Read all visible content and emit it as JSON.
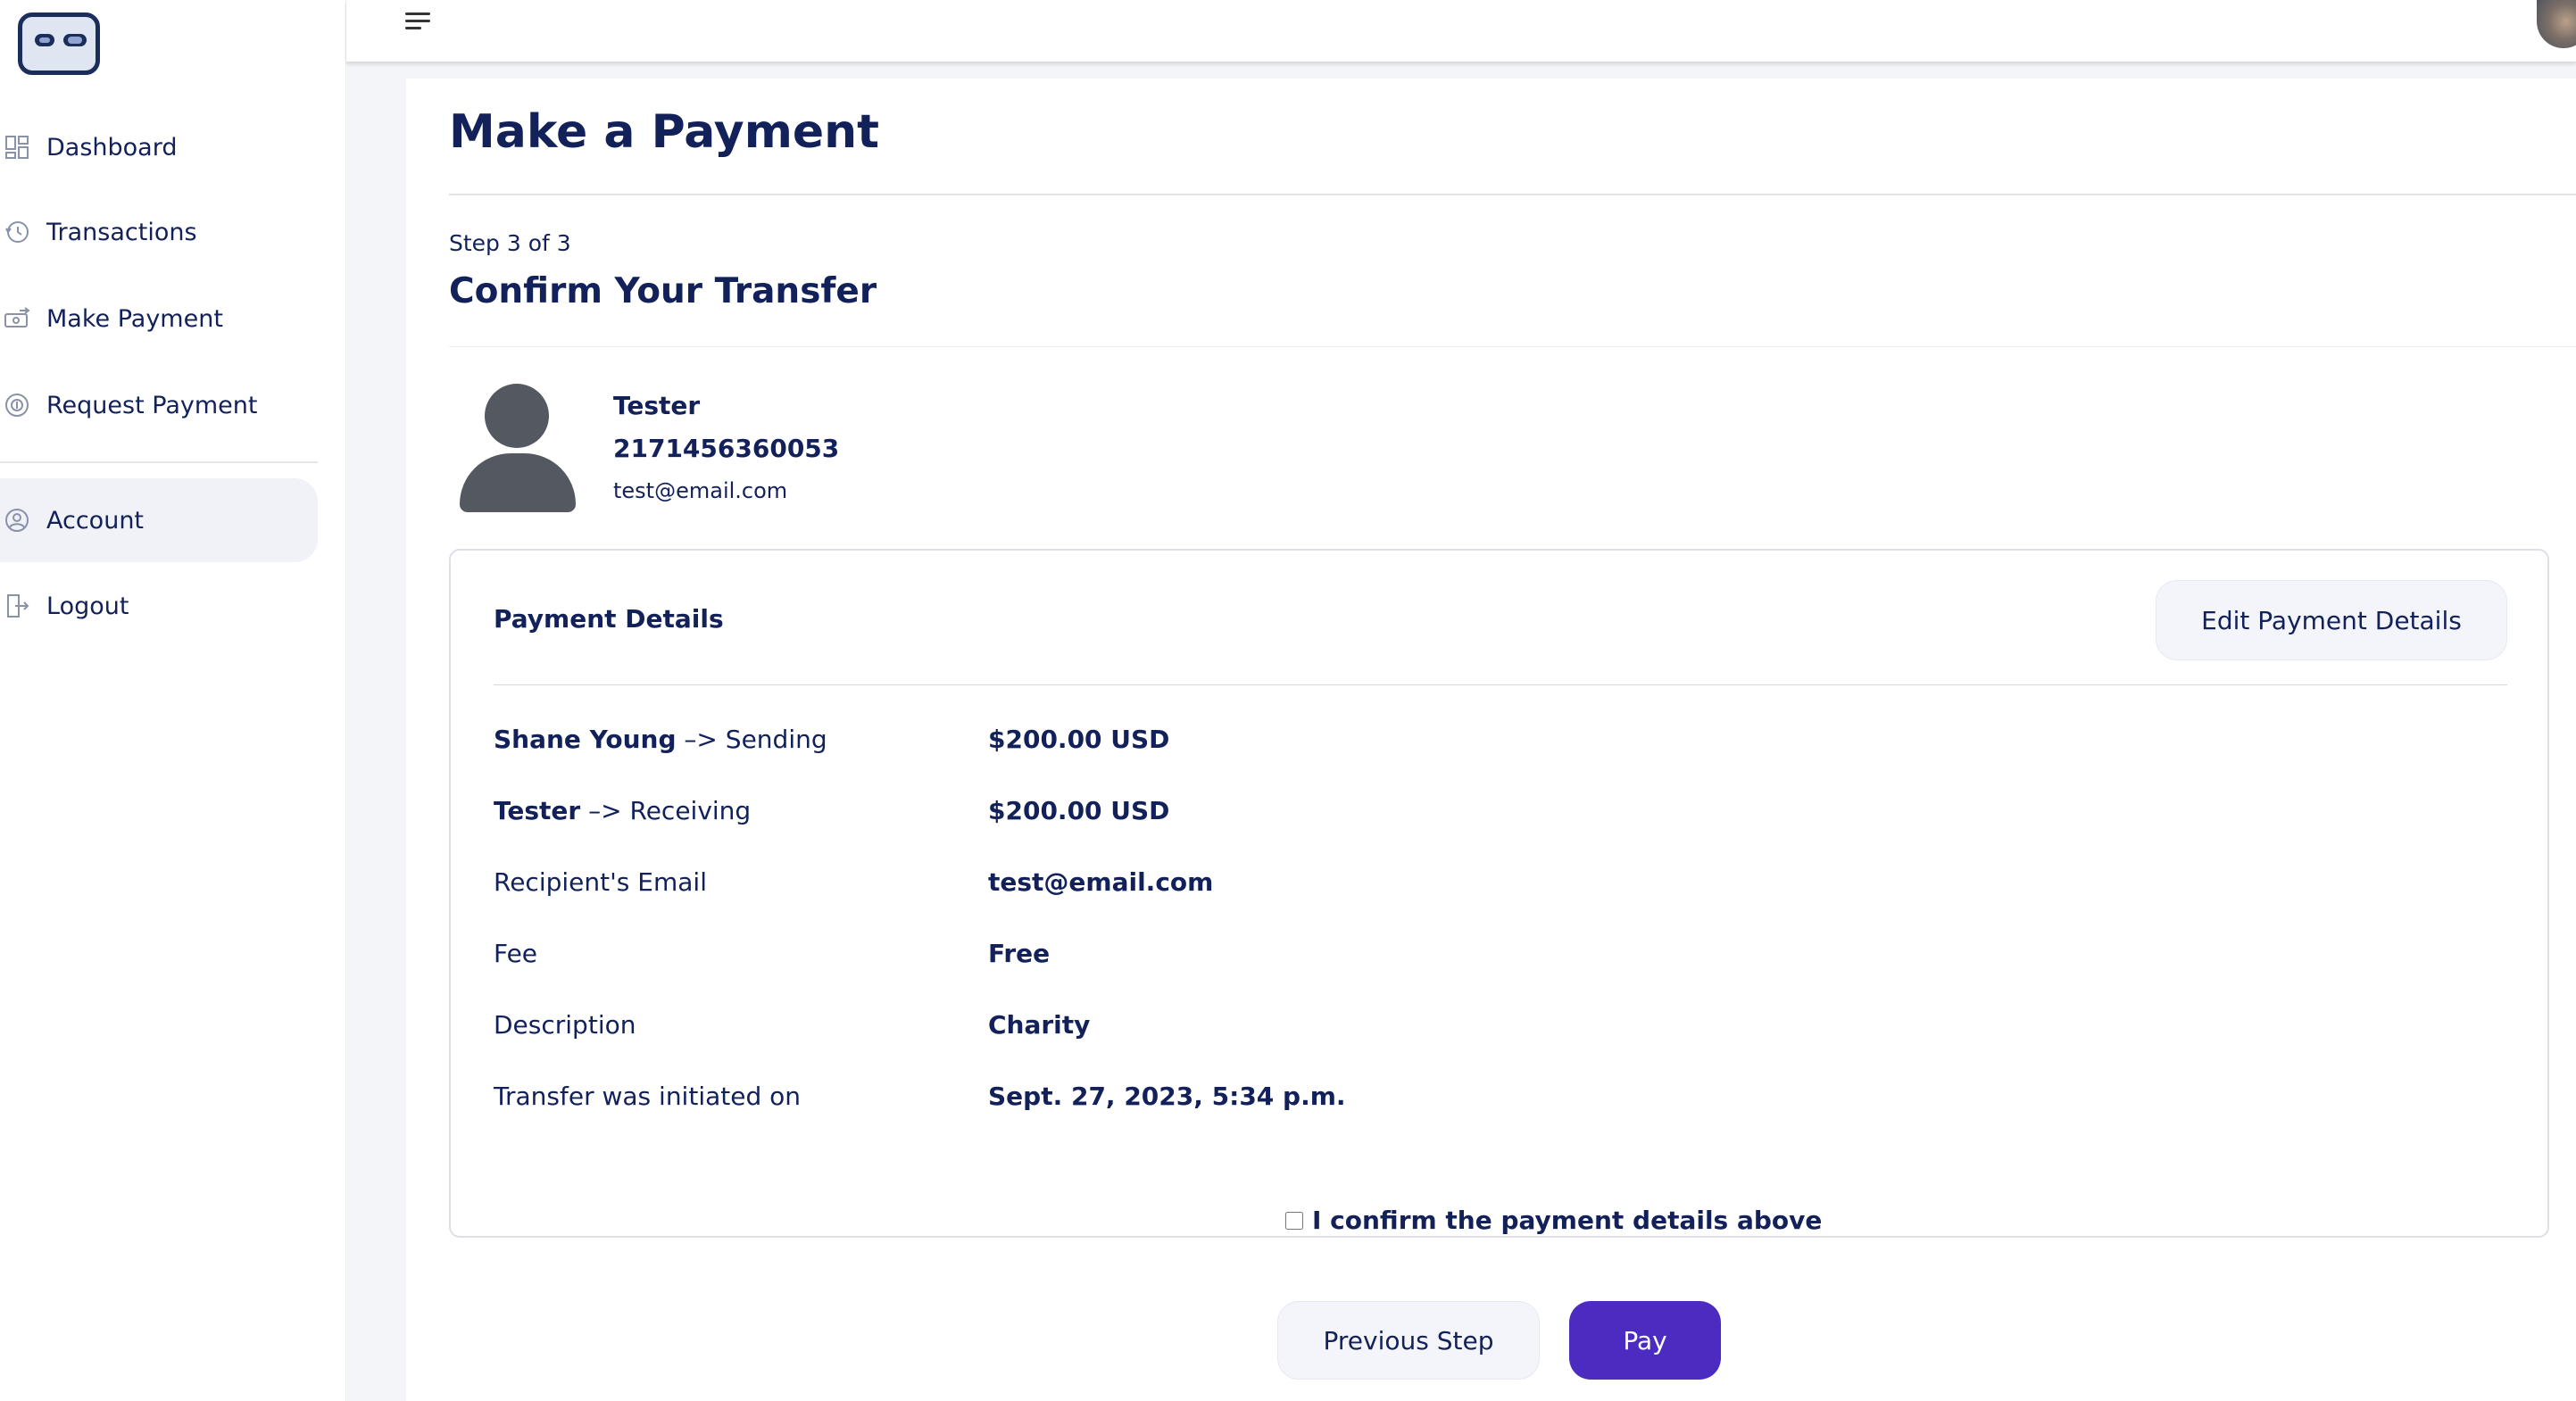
{
  "sidebar": {
    "items": [
      {
        "label": "Dashboard",
        "icon": "dashboard-icon"
      },
      {
        "label": "Transactions",
        "icon": "history-icon"
      },
      {
        "label": "Make Payment",
        "icon": "send-money-icon"
      },
      {
        "label": "Request Payment",
        "icon": "request-money-icon"
      },
      {
        "label": "Account",
        "icon": "user-circle-icon",
        "active": true
      },
      {
        "label": "Logout",
        "icon": "logout-icon"
      }
    ]
  },
  "page": {
    "title": "Make a Payment",
    "step": "Step 3 of 3",
    "subtitle": "Confirm Your Transfer"
  },
  "recipient": {
    "name": "Tester",
    "account_number": "2171456360053",
    "email": "test@email.com"
  },
  "details": {
    "title": "Payment Details",
    "edit_label": "Edit Payment Details",
    "rows": [
      {
        "label_bold": "Shane Young",
        "label_rest": " –> Sending",
        "value": "$200.00 USD"
      },
      {
        "label_bold": "Tester",
        "label_rest": " –> Receiving",
        "value": "$200.00 USD"
      },
      {
        "label_bold": "",
        "label_rest": "Recipient's Email",
        "value": "test@email.com"
      },
      {
        "label_bold": "",
        "label_rest": "Fee",
        "value": "Free"
      },
      {
        "label_bold": "",
        "label_rest": "Description",
        "value": "Charity"
      },
      {
        "label_bold": "",
        "label_rest": "Transfer was initiated on",
        "value": "Sept. 27, 2023, 5:34 p.m."
      }
    ]
  },
  "confirm": {
    "label": "I confirm the payment details above",
    "checked": false
  },
  "actions": {
    "previous_label": "Previous Step",
    "pay_label": "Pay"
  },
  "colors": {
    "primary": "#4c2cc0",
    "text": "#12215a"
  }
}
